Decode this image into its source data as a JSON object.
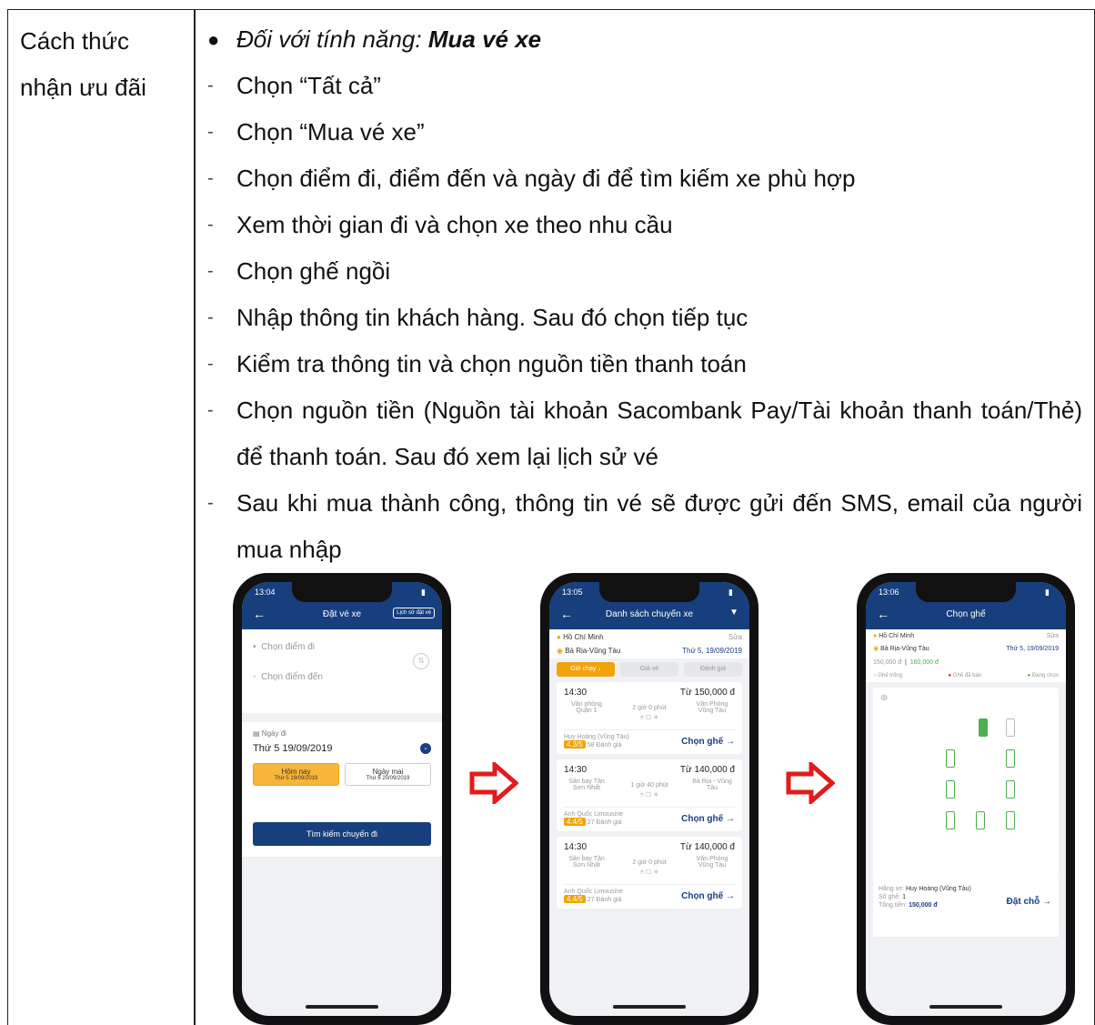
{
  "table": {
    "label": [
      "Cách thức",
      "nhận ưu đãi"
    ],
    "heading_prefix": "Đối với tính năng: ",
    "heading_bold": "Mua vé xe",
    "steps": [
      "Chọn “Tất cả”",
      "Chọn “Mua vé xe”",
      "Chọn điểm đi, điểm đến và ngày đi để tìm kiếm xe phù hợp",
      "Xem thời gian đi và chọn xe theo nhu cầu",
      "Chọn ghế ngồi",
      "Nhập thông tin khách hàng. Sau đó chọn tiếp tục",
      "Kiểm tra thông tin và chọn nguồn tiền thanh toán",
      "Chọn nguồn tiền (Nguồn tài khoản Sacombank Pay/Tài khoản thanh toán/Thẻ) để thanh toán. Sau đó xem lại lịch sử vé",
      "Sau khi mua thành công, thông tin vé sẽ được gửi đến SMS, email của người mua nhập"
    ]
  },
  "phone1": {
    "time": "13:04",
    "title": "Đặt vé xe",
    "history_btn": "Lịch sử đặt vé",
    "from_placeholder": "Chọn điểm đi",
    "to_placeholder": "Chọn điểm đến",
    "date_label": "Ngày đi",
    "date_value": "Thứ 5 19/09/2019",
    "today_label": "Hôm nay",
    "today_date": "Thứ 5 19/09/2019",
    "tomorrow_label": "Ngày mai",
    "tomorrow_date": "Thứ 6 20/09/2019",
    "search_btn": "Tìm kiếm chuyến đi"
  },
  "phone2": {
    "time": "13:05",
    "title": "Danh sách chuyến xe",
    "from": "Hồ Chí Minh",
    "edit": "Sửa",
    "to": "Bà Rịa-Vũng Tàu",
    "date": "Thứ 5, 19/09/2019",
    "tabs": [
      "Giờ chạy ↓",
      "Giá vé",
      "Đánh giá"
    ],
    "select_seat": "Chọn ghế →",
    "trips": [
      {
        "time": "14:30",
        "price": "Từ 150,000 đ",
        "origin": "Văn phòng Quận 1",
        "duration": "2 giờ 0 phút",
        "dest": "Văn Phòng Vũng Tàu",
        "operator": "Huy Hoàng (Vũng Tàu)",
        "rating": "4.3/5",
        "reviews": "58 Đánh giá"
      },
      {
        "time": "14:30",
        "price": "Từ 140,000 đ",
        "origin": "Sân bay Tân Sơn Nhất",
        "duration": "1 giờ 40 phút",
        "dest": "Bà Rịa - Vũng Tàu",
        "operator": "Anh Quốc Limousine",
        "rating": "4.4/5",
        "reviews": "27 Đánh giá"
      },
      {
        "time": "14:30",
        "price": "Từ 140,000 đ",
        "origin": "Sân bay Tân Sơn Nhất",
        "duration": "2 giờ 0 phút",
        "dest": "Văn Phòng Vũng Tàu",
        "operator": "Anh Quốc Limousine",
        "rating": "4.4/5",
        "reviews": "27 Đánh giá"
      }
    ]
  },
  "phone3": {
    "time": "13:06",
    "title": "Chọn ghế",
    "from": "Hồ Chí Minh",
    "edit": "Sửa",
    "to": "Bà Rịa-Vũng Tàu",
    "date": "Thứ 5, 19/09/2019",
    "price_a": "150,000 đ",
    "price_b": "160,000 đ",
    "legend": [
      "Ghế trống",
      "Ghế đã bán",
      "Đang chọn"
    ],
    "operator_label": "Hãng xe:",
    "operator": "Huy Hoàng (Vũng Tàu)",
    "seat_label": "Số ghế:",
    "seat_count": "1",
    "total_label": "Tổng tiền:",
    "total": "150,000 đ",
    "book": "Đặt chỗ →"
  },
  "colors": {
    "navy": "#173e7d",
    "orange": "#f0a30a",
    "arrow_red": "#e21b1b",
    "seat_green": "#4caf50"
  }
}
